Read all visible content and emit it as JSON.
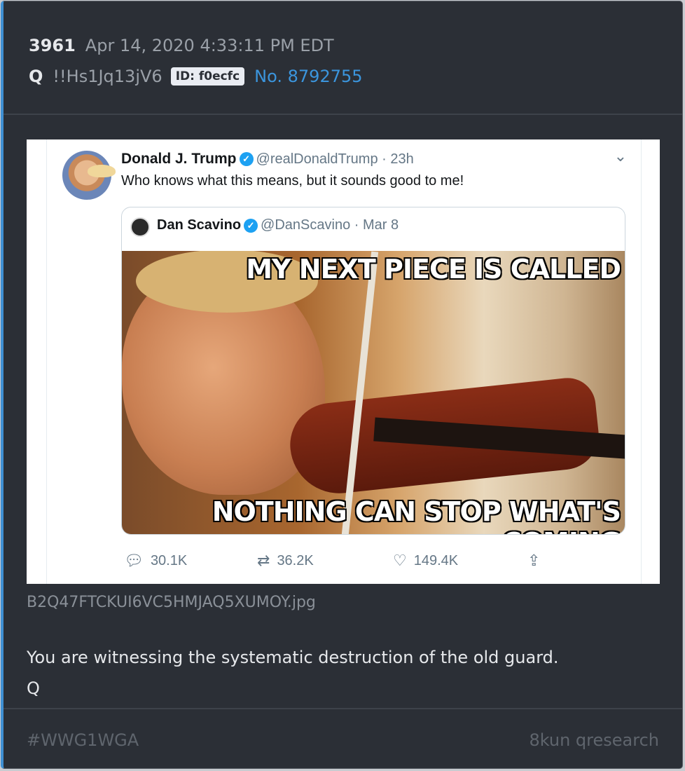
{
  "post": {
    "number": "3961",
    "timestamp": "Apr 14, 2020 4:33:11 PM EDT",
    "author": "Q",
    "tripcode": "!!Hs1Jq13jV6",
    "id_badge": "ID: f0ecfc",
    "post_link": "No. 8792755"
  },
  "tweet": {
    "name": "Donald J. Trump",
    "handle_time": "@realDonaldTrump · 23h",
    "text": "Who knows what this means, but it sounds good to me!",
    "quote": {
      "name": "Dan Scavino",
      "handle_time": "@DanScavino · Mar 8",
      "meme_top": "MY NEXT PIECE IS CALLED",
      "meme_bottom": "NOTHING CAN STOP WHAT'S COMING"
    },
    "actions": {
      "replies": "30.1K",
      "retweets": "36.2K",
      "likes": "149.4K"
    }
  },
  "attachment": {
    "filename": "B2Q47FTCKUI6VC5HMJAQ5XUMOY.jpg"
  },
  "message": {
    "line1": "You are witnessing the systematic destruction of the old guard.",
    "line2": "Q"
  },
  "footer": {
    "hashtag": "#WWG1WGA",
    "source": "8kun qresearch"
  },
  "colors": {
    "accent": "#3f8fd2",
    "link": "#3b95dd",
    "background": "#2b2f36"
  },
  "icons": [
    "verified-badge-icon",
    "chevron-down-icon",
    "reply-icon",
    "retweet-icon",
    "like-icon",
    "share-icon"
  ]
}
